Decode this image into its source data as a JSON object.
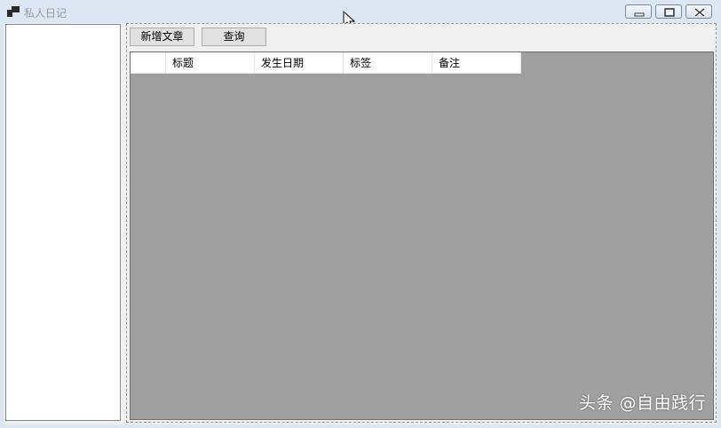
{
  "window": {
    "title": "私人日记",
    "controls": [
      "minimize-icon",
      "maximize-icon",
      "close-icon"
    ]
  },
  "toolbar": {
    "new_article_label": "新增文章",
    "query_label": "查询"
  },
  "grid": {
    "columns": [
      "",
      "标题",
      "发生日期",
      "标签",
      "备注"
    ],
    "rows": []
  },
  "watermark": "头条 @自由践行",
  "colors": {
    "frame": "#dde6f3",
    "grid_background": "#a0a0a0",
    "button_face": "#e1e1e1"
  }
}
